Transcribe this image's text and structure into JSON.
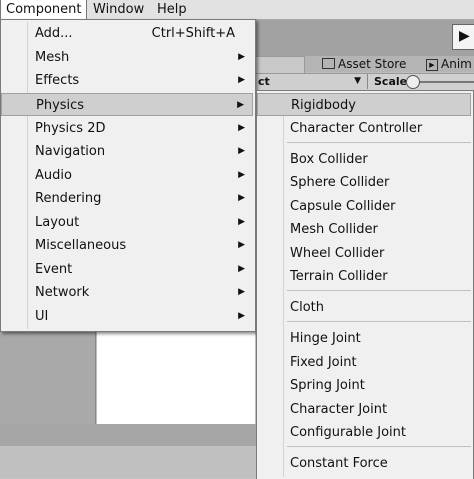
{
  "menubar": {
    "items": [
      {
        "label": "Component",
        "active": true
      },
      {
        "label": "Window",
        "active": false
      },
      {
        "label": "Help",
        "active": false
      }
    ]
  },
  "editor": {
    "tabs": {
      "asset_store": "Asset Store",
      "animator": "Anim"
    },
    "dropdown_fragment": "ct",
    "scale_label": "Scale"
  },
  "component_menu": {
    "items": [
      {
        "label": "Add...",
        "shortcut": "Ctrl+Shift+A",
        "submenu": false
      },
      {
        "label": "Mesh",
        "submenu": true
      },
      {
        "label": "Effects",
        "submenu": true
      },
      {
        "label": "Physics",
        "submenu": true,
        "highlighted": true
      },
      {
        "label": "Physics 2D",
        "submenu": true
      },
      {
        "label": "Navigation",
        "submenu": true
      },
      {
        "label": "Audio",
        "submenu": true
      },
      {
        "label": "Rendering",
        "submenu": true
      },
      {
        "label": "Layout",
        "submenu": true
      },
      {
        "label": "Miscellaneous",
        "submenu": true
      },
      {
        "label": "Event",
        "submenu": true
      },
      {
        "label": "Network",
        "submenu": true
      },
      {
        "label": "UI",
        "submenu": true
      }
    ]
  },
  "physics_submenu": {
    "groups": [
      [
        "Rigidbody",
        "Character Controller"
      ],
      [
        "Box Collider",
        "Sphere Collider",
        "Capsule Collider",
        "Mesh Collider",
        "Wheel Collider",
        "Terrain Collider"
      ],
      [
        "Cloth"
      ],
      [
        "Hinge Joint",
        "Fixed Joint",
        "Spring Joint",
        "Character Joint",
        "Configurable Joint"
      ],
      [
        "Constant Force"
      ]
    ],
    "highlighted": "Rigidbody"
  },
  "icons": {
    "submenu_arrow": "triangle-right-icon",
    "dropdown_arrow": "triangle-down-icon",
    "play": "play-icon"
  }
}
